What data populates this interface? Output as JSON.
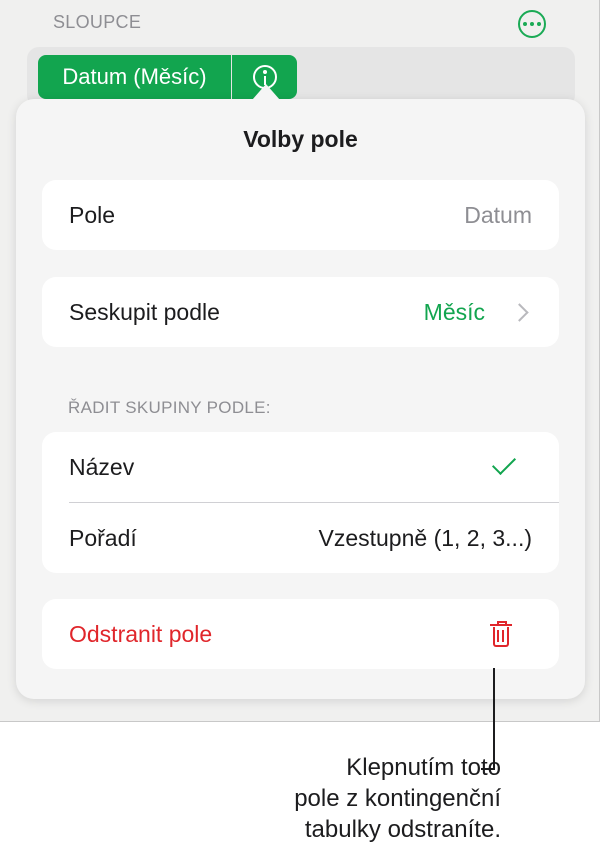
{
  "section": {
    "label": "SLOUPCE",
    "more_icon": "ellipsis-circle-icon"
  },
  "field_chip": {
    "label": "Datum (Měsíc)",
    "info_icon": "info-circle-icon"
  },
  "popover": {
    "title": "Volby pole",
    "field_row": {
      "label": "Pole",
      "value": "Datum"
    },
    "group_by_row": {
      "label": "Seskupit podle",
      "value": "Měsíc",
      "chevron_icon": "chevron-right-icon"
    },
    "sort_section_label": "ŘADIT SKUPINY PODLE:",
    "sort_rows": [
      {
        "label": "Název",
        "selected": true,
        "icon": "checkmark-icon"
      },
      {
        "label": "Pořadí",
        "value": "Vzestupně (1, 2, 3...)"
      }
    ],
    "delete_row": {
      "label": "Odstranit pole",
      "icon": "trash-icon"
    }
  },
  "callout": {
    "text": "Klepnutím toto\npole z kontingenční\ntabulky odstraníte."
  },
  "colors": {
    "accent": "#12a54f",
    "destructive": "#e0262b",
    "secondary_text": "#8e8e93"
  }
}
